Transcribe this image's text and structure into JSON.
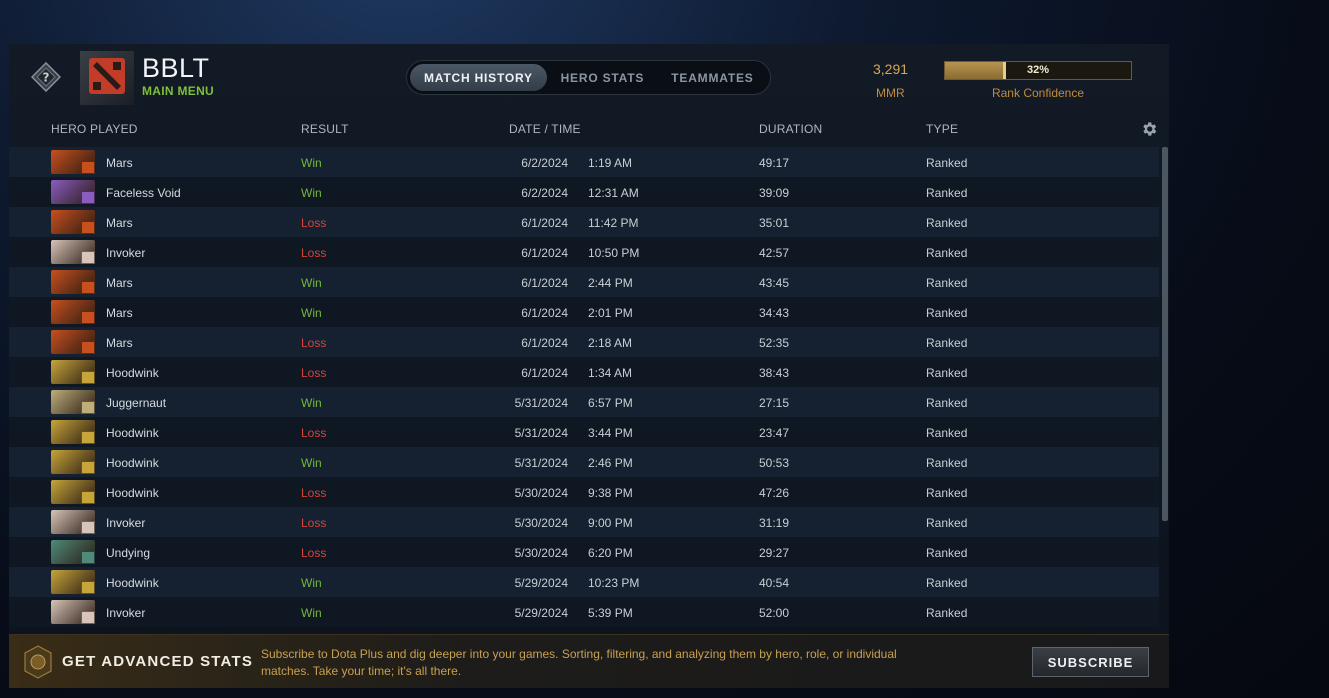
{
  "player": {
    "name": "BBLT",
    "sub": "MAIN MENU"
  },
  "tabs": [
    {
      "label": "MATCH HISTORY",
      "active": true
    },
    {
      "label": "HERO STATS",
      "active": false
    },
    {
      "label": "TEAMMATES",
      "active": false
    }
  ],
  "rank": {
    "mmr": "3,291",
    "mmr_label": "MMR",
    "confidence": "32%",
    "confidence_fraction": 0.32,
    "confidence_label": "Rank Confidence"
  },
  "columns": {
    "hero": "HERO PLAYED",
    "result": "RESULT",
    "datetime": "DATE / TIME",
    "duration": "DURATION",
    "type": "TYPE"
  },
  "matches": [
    {
      "hero": "Mars",
      "result": "Win",
      "date": "6/2/2024",
      "time": "1:19 AM",
      "duration": "49:17",
      "type": "Ranked"
    },
    {
      "hero": "Faceless Void",
      "result": "Win",
      "date": "6/2/2024",
      "time": "12:31 AM",
      "duration": "39:09",
      "type": "Ranked"
    },
    {
      "hero": "Mars",
      "result": "Loss",
      "date": "6/1/2024",
      "time": "11:42 PM",
      "duration": "35:01",
      "type": "Ranked"
    },
    {
      "hero": "Invoker",
      "result": "Loss",
      "date": "6/1/2024",
      "time": "10:50 PM",
      "duration": "42:57",
      "type": "Ranked"
    },
    {
      "hero": "Mars",
      "result": "Win",
      "date": "6/1/2024",
      "time": "2:44 PM",
      "duration": "43:45",
      "type": "Ranked"
    },
    {
      "hero": "Mars",
      "result": "Win",
      "date": "6/1/2024",
      "time": "2:01 PM",
      "duration": "34:43",
      "type": "Ranked"
    },
    {
      "hero": "Mars",
      "result": "Loss",
      "date": "6/1/2024",
      "time": "2:18 AM",
      "duration": "52:35",
      "type": "Ranked"
    },
    {
      "hero": "Hoodwink",
      "result": "Loss",
      "date": "6/1/2024",
      "time": "1:34 AM",
      "duration": "38:43",
      "type": "Ranked"
    },
    {
      "hero": "Juggernaut",
      "result": "Win",
      "date": "5/31/2024",
      "time": "6:57 PM",
      "duration": "27:15",
      "type": "Ranked"
    },
    {
      "hero": "Hoodwink",
      "result": "Loss",
      "date": "5/31/2024",
      "time": "3:44 PM",
      "duration": "23:47",
      "type": "Ranked"
    },
    {
      "hero": "Hoodwink",
      "result": "Win",
      "date": "5/31/2024",
      "time": "2:46 PM",
      "duration": "50:53",
      "type": "Ranked"
    },
    {
      "hero": "Hoodwink",
      "result": "Loss",
      "date": "5/30/2024",
      "time": "9:38 PM",
      "duration": "47:26",
      "type": "Ranked"
    },
    {
      "hero": "Invoker",
      "result": "Loss",
      "date": "5/30/2024",
      "time": "9:00 PM",
      "duration": "31:19",
      "type": "Ranked"
    },
    {
      "hero": "Undying",
      "result": "Loss",
      "date": "5/30/2024",
      "time": "6:20 PM",
      "duration": "29:27",
      "type": "Ranked"
    },
    {
      "hero": "Hoodwink",
      "result": "Win",
      "date": "5/29/2024",
      "time": "10:23 PM",
      "duration": "40:54",
      "type": "Ranked"
    },
    {
      "hero": "Invoker",
      "result": "Win",
      "date": "5/29/2024",
      "time": "5:39 PM",
      "duration": "52:00",
      "type": "Ranked"
    }
  ],
  "hero_colors": {
    "Mars": "#c8501e",
    "Faceless Void": "#8a5cc0",
    "Invoker": "#d8c4b8",
    "Hoodwink": "#c7a53a",
    "Juggernaut": "#bfae7a",
    "Undying": "#4f8a7a"
  },
  "colors": {
    "win": "#73b83a",
    "loss": "#d6443a",
    "accent_gold": "#d9a657"
  },
  "icons": {
    "rank": "question-badge-icon",
    "settings": "gear-icon",
    "plus": "dota-plus-icon",
    "avatar": "dota-logo-icon"
  },
  "footer": {
    "title": "GET ADVANCED STATS",
    "description": "Subscribe to Dota Plus and dig deeper into your games. Sorting, filtering, and analyzing them by hero, role, or individual matches. Take your time; it's all there.",
    "button": "SUBSCRIBE"
  }
}
